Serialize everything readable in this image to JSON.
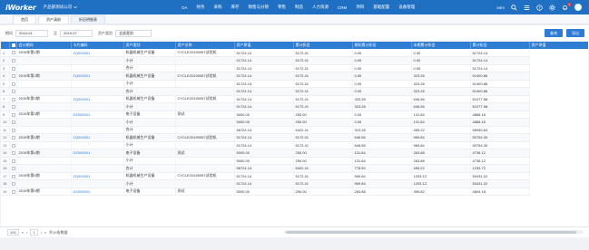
{
  "app": {
    "logo": "iWorker",
    "company": "产品部测试公司"
  },
  "nav": [
    "OA",
    "财务",
    "采购",
    "库存",
    "销售与分销",
    "零售",
    "制造",
    "人力资源",
    "CRM",
    "项目",
    "基础配置",
    "设备管理"
  ],
  "toolbar": {
    "user": "MES",
    "notifications": "1"
  },
  "tabs": [
    "首页",
    "资产清册",
    "折旧明细表"
  ],
  "filter": {
    "from_label": "期间",
    "from_value": "2019-01",
    "to_label": "至",
    "to_value": "2019-07",
    "type_label": "资产类别",
    "type_value": "全部类别",
    "query_button": "查询",
    "export_button": "导出"
  },
  "table": {
    "columns": [
      "会计期间",
      "卡片编码",
      "资产类别",
      "资产名称",
      "资产原值",
      "累计折旧",
      "期初累计折旧",
      "本期累计折旧",
      "累计折旧",
      "资产净值"
    ],
    "rows": [
      [
        "1",
        "2019年第1期",
        "ZQ000001",
        "机器机械生产设备",
        "CYCLE20190057试验机",
        "51724.14",
        "5172.41",
        "0.00",
        "0.00",
        "51724.14"
      ],
      [
        "2",
        "",
        "",
        "小计",
        "",
        "51724.14",
        "5172.41",
        "0.00",
        "0.00",
        "51724.14"
      ],
      [
        "3",
        "",
        "",
        "合计",
        "",
        "51724.14",
        "5172.41",
        "0.00",
        "0.00",
        "51724.14"
      ],
      [
        "4",
        "2019年第2期",
        "ZQ000001",
        "机器机械生产设备",
        "CYCLE20190057试验机",
        "51724.14",
        "5172.41",
        "0.00",
        "323.28",
        "51400.86"
      ],
      [
        "5",
        "",
        "",
        "小计",
        "",
        "51724.14",
        "5172.41",
        "0.00",
        "323.28",
        "51400.86"
      ],
      [
        "6",
        "",
        "",
        "合计",
        "",
        "51724.14",
        "5172.41",
        "0.00",
        "323.28",
        "51400.86"
      ],
      [
        "7",
        "2019年第3期",
        "ZQ000001",
        "机器机械生产设备",
        "CYCLE20190057试验机",
        "51724.14",
        "5172.41",
        "323.28",
        "646.56",
        "51077.58"
      ],
      [
        "8",
        "",
        "",
        "小计",
        "",
        "51724.14",
        "5172.41",
        "323.28",
        "646.56",
        "51077.58"
      ],
      [
        "9",
        "2019年第3期",
        "DZ000001",
        "电子设备",
        "测试",
        "5000.00",
        "250.00",
        "0.00",
        "131.84",
        "4868.16"
      ],
      [
        "10",
        "",
        "",
        "小计",
        "",
        "5000.00",
        "250.00",
        "0.00",
        "131.84",
        "4868.16"
      ],
      [
        "11",
        "",
        "",
        "合计",
        "",
        "56724.14",
        "5422.41",
        "323.28",
        "455.22",
        "55945.64"
      ],
      [
        "12",
        "2019年第4期",
        "ZQ000001",
        "机器机械生产设备",
        "CYCLE20190057试验机",
        "51724.14",
        "5172.41",
        "646.56",
        "969.84",
        "50754.30"
      ],
      [
        "13",
        "",
        "",
        "小计",
        "",
        "51724.14",
        "5172.41",
        "646.56",
        "969.84",
        "50754.30"
      ],
      [
        "14",
        "2019年第4期",
        "DZ000001",
        "电子设备",
        "测试",
        "5000.00",
        "250.00",
        "131.84",
        "263.88",
        "4736.12"
      ],
      [
        "15",
        "",
        "",
        "小计",
        "",
        "5000.00",
        "250.00",
        "131.84",
        "263.88",
        "4736.12"
      ],
      [
        "16",
        "",
        "",
        "合计",
        "",
        "56724.14",
        "5422.41",
        "778.50",
        "455.22",
        "1233.72"
      ],
      [
        "17",
        "2019年第5期",
        "ZQ000001",
        "机器机械生产设备",
        "CYCLE20190057试验机",
        "51724.14",
        "5172.41",
        "969.84",
        "1293.12",
        "50431.02"
      ],
      [
        "18",
        "",
        "",
        "小计",
        "",
        "51724.14",
        "5172.41",
        "969.84",
        "1293.12",
        "50431.02"
      ],
      [
        "19",
        "2019年第5期",
        "DZ000001",
        "电子设备",
        "测试",
        "5000.00",
        "250.00",
        "263.88",
        "395.82",
        "4604.18"
      ]
    ]
  },
  "footer": {
    "page_size": "100",
    "first": "«",
    "prev": "‹",
    "page": "1",
    "next": "›",
    "last": "»",
    "total": "共19条数据"
  }
}
